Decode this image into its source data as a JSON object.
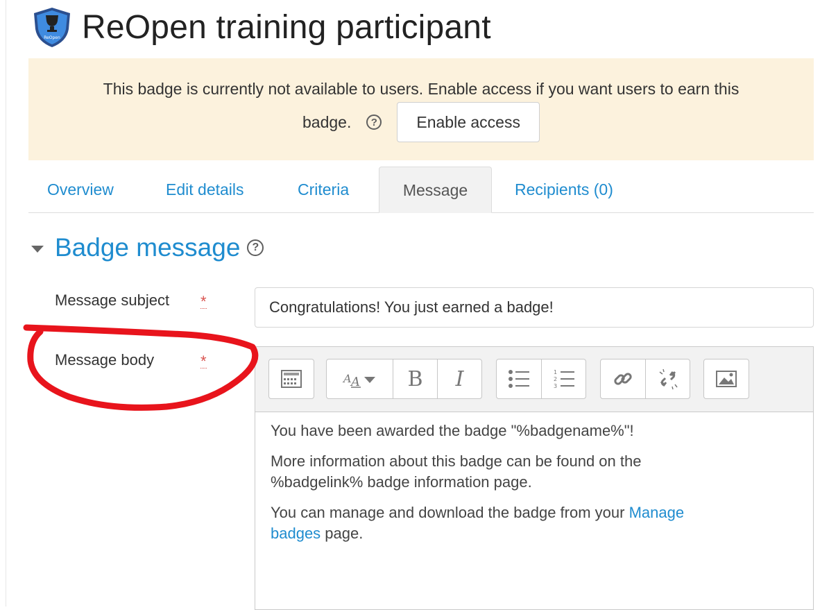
{
  "header": {
    "title": "ReOpen training participant",
    "badge_icon_text": "ReOpen"
  },
  "alert": {
    "text_line1": "This badge is currently not available to users. Enable access if you want users to earn this",
    "text_line2": "badge.",
    "help_icon": "?",
    "button_label": "Enable access"
  },
  "tabs": [
    {
      "label": "Overview"
    },
    {
      "label": "Edit details"
    },
    {
      "label": "Criteria"
    },
    {
      "label": "Message",
      "active": true
    },
    {
      "label": "Recipients (0)"
    }
  ],
  "section": {
    "title": "Badge message",
    "help_icon": "?"
  },
  "form": {
    "subject_label": "Message subject",
    "subject_value": "Congratulations! You just earned a badge!",
    "body_label": "Message body",
    "required_mark": "*"
  },
  "editor": {
    "toolbar_icons": [
      "toolbar-toggle-icon",
      "font-style-icon",
      "bold-icon",
      "italic-icon",
      "bullet-list-icon",
      "numbered-list-icon",
      "link-icon",
      "unlink-icon",
      "image-icon"
    ],
    "bold_glyph": "B",
    "italic_glyph": "I",
    "paragraph1": "You have been awarded the badge \"%badgename%\"!",
    "paragraph2_line1": "More information about this badge can be found on the",
    "paragraph2_line2": "%badgelink% badge information page.",
    "paragraph3_prefix": "You can manage and download the badge from your ",
    "paragraph3_link_part1": "Manage",
    "paragraph3_link_part2": "badges",
    "paragraph3_suffix": " page."
  },
  "colors": {
    "accent": "#1f8ccf",
    "alert_bg": "#fcf2dd",
    "required": "#d9534f",
    "annotation": "#e8141c"
  }
}
